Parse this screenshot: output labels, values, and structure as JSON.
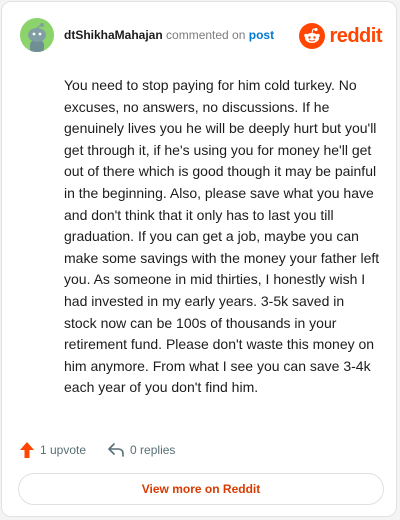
{
  "comment": {
    "author": "dtShikhaMahajan",
    "action_text": "commented on",
    "post_link_text": "post",
    "body": "You need to stop paying for him cold turkey. No excuses, no answers, no discussions. If he genuinely lives you he will be deeply hurt but you'll get through it, if he's using you for money he'll get out of there which is good though it may be painful in the beginning. Also, please save what you have and don't think that it only has to last you till graduation. If you can get a job, maybe you can make some savings with the money your father left you. As someone in mid thirties, I honestly wish I had invested in my early years. 3-5k saved in stock now can be 100s of thousands in your retirement fund. Please don't waste this money on him anymore. From what I see you can save 3-4k each year of you don't find him."
  },
  "brand": {
    "wordmark": "reddit",
    "color": "#ff4500"
  },
  "actions": {
    "upvote_label": "1 upvote",
    "upvote_icon": "upvote-arrow-icon",
    "reply_label": "0 replies",
    "reply_icon": "reply-arrow-icon"
  },
  "cta": {
    "label": "View more on Reddit",
    "color": "#d93a00"
  },
  "colors": {
    "avatar_bg": "#8bd36a",
    "link": "#0079d3",
    "upvote": "#ff4500"
  }
}
